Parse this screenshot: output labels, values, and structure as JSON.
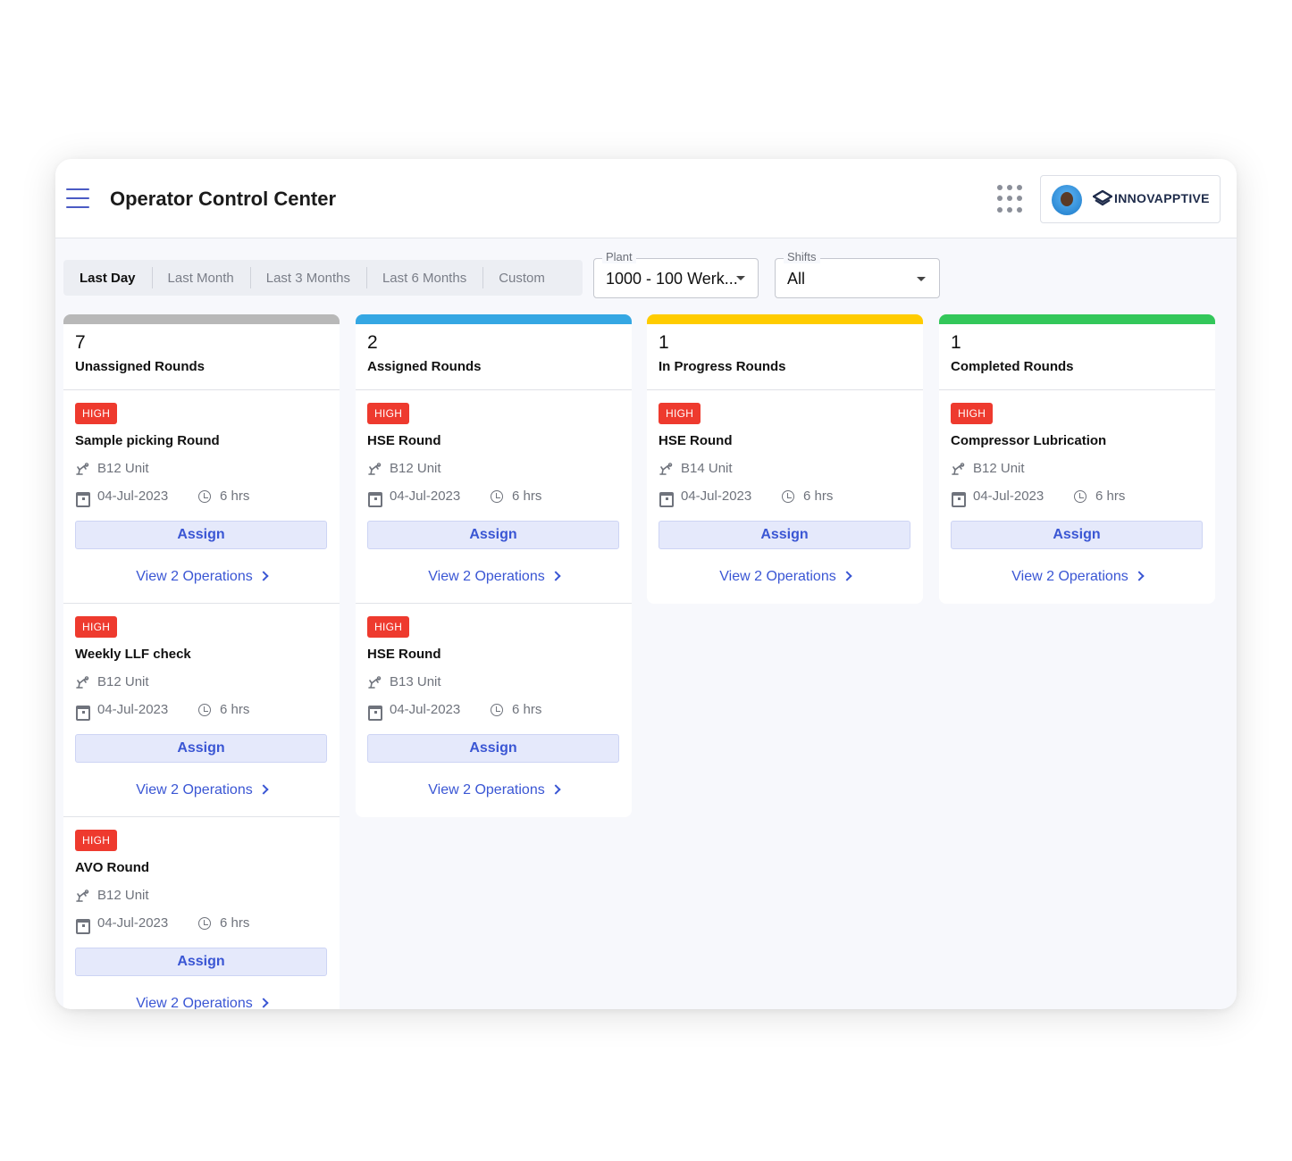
{
  "header": {
    "title": "Operator Control Center",
    "brand": "INNOVAPPTIVE"
  },
  "date_range": {
    "options": [
      "Last Day",
      "Last Month",
      "Last 3 Months",
      "Last 6 Months",
      "Custom"
    ],
    "selected": "Last Day"
  },
  "filters": {
    "plant": {
      "label": "Plant",
      "value": "1000 - 100 Werk..."
    },
    "shifts": {
      "label": "Shifts",
      "value": "All"
    }
  },
  "columns": [
    {
      "count": "7",
      "label": "Unassigned Rounds",
      "color": "#b8b8b8",
      "cards": [
        {
          "priority": "HIGH",
          "title": "Sample picking Round",
          "unit": "B12 Unit",
          "date": "04-Jul-2023",
          "duration": "6 hrs",
          "action": "Assign",
          "link": "View 2 Operations"
        },
        {
          "priority": "HIGH",
          "title": "Weekly LLF check",
          "unit": "B12 Unit",
          "date": "04-Jul-2023",
          "duration": "6 hrs",
          "action": "Assign",
          "link": "View 2 Operations"
        },
        {
          "priority": "HIGH",
          "title": "AVO Round",
          "unit": "B12 Unit",
          "date": "04-Jul-2023",
          "duration": "6 hrs",
          "action": "Assign",
          "link": "View 2 Operations"
        }
      ]
    },
    {
      "count": "2",
      "label": "Assigned Rounds",
      "color": "#35a7e3",
      "cards": [
        {
          "priority": "HIGH",
          "title": "HSE Round",
          "unit": "B12 Unit",
          "date": "04-Jul-2023",
          "duration": "6 hrs",
          "action": "Assign",
          "link": "View 2 Operations"
        },
        {
          "priority": "HIGH",
          "title": "HSE Round",
          "unit": "B13 Unit",
          "date": "04-Jul-2023",
          "duration": "6 hrs",
          "action": "Assign",
          "link": "View 2 Operations"
        }
      ]
    },
    {
      "count": "1",
      "label": "In Progress Rounds",
      "color": "#ffcc00",
      "cards": [
        {
          "priority": "HIGH",
          "title": "HSE Round",
          "unit": "B14 Unit",
          "date": "04-Jul-2023",
          "duration": "6 hrs",
          "action": "Assign",
          "link": "View 2 Operations"
        }
      ]
    },
    {
      "count": "1",
      "label": "Completed Rounds",
      "color": "#33c75a",
      "cards": [
        {
          "priority": "HIGH",
          "title": "Compressor Lubrication",
          "unit": "B12 Unit",
          "date": "04-Jul-2023",
          "duration": "6 hrs",
          "action": "Assign",
          "link": "View 2 Operations"
        }
      ]
    }
  ],
  "icons": {
    "menu": "hamburger-menu-icon",
    "apps": "apps-grid-icon",
    "unit": "robot-arm-icon",
    "date": "calendar-icon",
    "duration": "clock-icon",
    "link": "chevron-right-icon"
  }
}
